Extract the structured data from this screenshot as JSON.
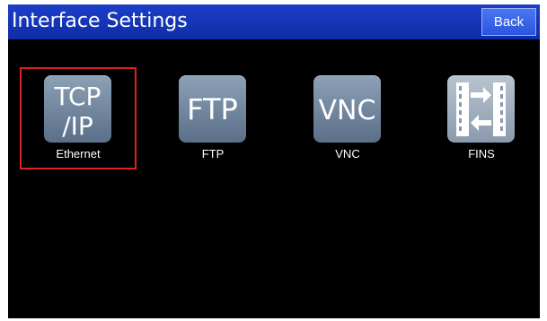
{
  "header": {
    "title": "Interface Settings",
    "back_label": "Back"
  },
  "tiles": [
    {
      "label": "Ethernet",
      "icon": "tcp-ip-icon",
      "selected": true
    },
    {
      "label": "FTP",
      "icon": "ftp-icon",
      "selected": false
    },
    {
      "label": "VNC",
      "icon": "vnc-icon",
      "selected": false
    },
    {
      "label": "FINS",
      "icon": "fins-icon",
      "selected": false
    }
  ],
  "icon_text": {
    "tcp_line1": "TCP",
    "tcp_line2": "/IP",
    "ftp": "FTP",
    "vnc": "VNC"
  },
  "colors": {
    "title_bar": "#1b3fc8",
    "back_button": "#2a55de",
    "selection_border": "#e02020",
    "icon_bg": "#6f839b"
  }
}
